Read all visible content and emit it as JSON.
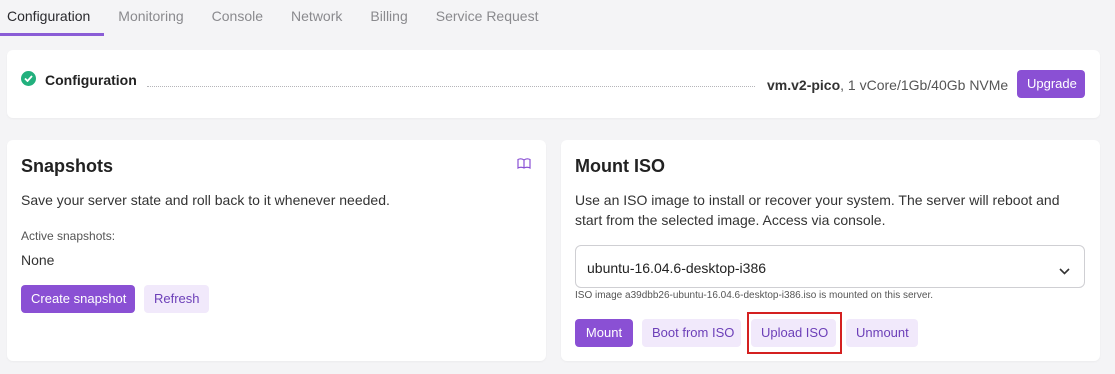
{
  "tabs": [
    "Configuration",
    "Monitoring",
    "Console",
    "Network",
    "Billing",
    "Service Request"
  ],
  "config": {
    "title": "Configuration",
    "plan_name": "vm.v2-pico",
    "plan_specs": ", 1 vCore/1Gb/40Gb NVMe",
    "upgrade_label": "Upgrade",
    "status_color": "#22b07d"
  },
  "snapshots": {
    "title": "Snapshots",
    "description": "Save your server state and roll back to it whenever needed.",
    "active_label": "Active snapshots:",
    "active_value": "None",
    "create_label": "Create snapshot",
    "refresh_label": "Refresh"
  },
  "mount_iso": {
    "title": "Mount ISO",
    "description_line1": "Use an ISO image to install or recover your system. The server will reboot and",
    "description_line2": "start from the selected image. Access via console.",
    "selected_iso": "ubuntu-16.04.6-desktop-i386",
    "note": "ISO image a39dbb26-ubuntu-16.04.6-desktop-i386.iso is mounted on this server.",
    "mount_label": "Mount",
    "boot_label": "Boot from ISO",
    "upload_label": "Upload ISO",
    "unmount_label": "Unmount"
  },
  "colors": {
    "accent": "#8a50d4",
    "accent_light": "#f1e9fb",
    "highlight": "#d42020"
  }
}
